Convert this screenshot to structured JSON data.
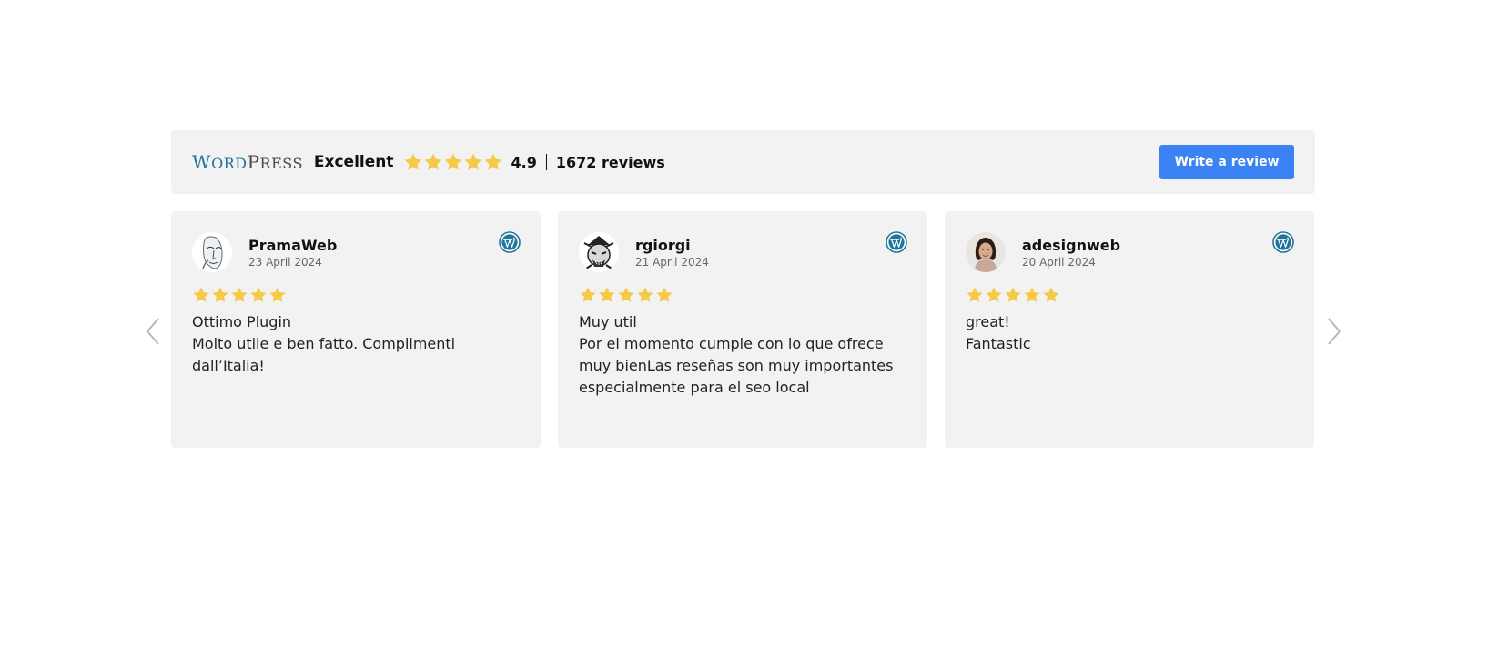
{
  "header": {
    "platform_logo": "WordPress",
    "logo_first": "W",
    "logo_rest1": "ORD",
    "logo_mid": "P",
    "logo_rest2": "RESS",
    "rating_word": "Excellent",
    "star_count": 5,
    "score": "4.9",
    "review_count": "1672 reviews",
    "write_button": "Write a review"
  },
  "reviews": [
    {
      "author": "PramaWeb",
      "date": "23 April 2024",
      "stars": 5,
      "title": "Ottimo Plugin",
      "text": "Molto utile e ben fatto. Complimenti dall’Italia!",
      "avatar_icon": "sketch-face-avatar"
    },
    {
      "author": "rgiorgi",
      "date": "21 April 2024",
      "stars": 5,
      "title": "Muy util",
      "text": "Por el momento cumple con lo que ofrece muy bienLas reseñas son muy importantes especialmente para el seo local",
      "avatar_icon": "samurai-avatar"
    },
    {
      "author": "adesignweb",
      "date": "20 April 2024",
      "stars": 5,
      "title": "great!",
      "text": "Fantastic",
      "avatar_icon": "woman-photo-avatar"
    }
  ],
  "colors": {
    "star": "#f7c948",
    "button": "#3b82f5",
    "wordpress_blue": "#21759b",
    "card_bg": "#f2f2f2"
  },
  "icons": {
    "prev": "chevron-left-icon",
    "next": "chevron-right-icon",
    "source": "wordpress-icon"
  }
}
